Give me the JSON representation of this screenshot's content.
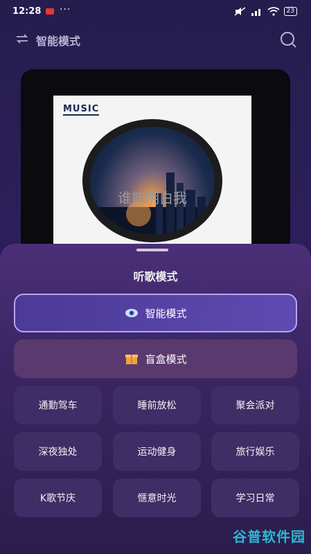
{
  "status": {
    "time": "12:28",
    "dots": "···",
    "battery": "23"
  },
  "header": {
    "title": "智能模式"
  },
  "player": {
    "logo": "MUSIC",
    "song": "谁能明白我"
  },
  "sheet": {
    "title": "听歌模式",
    "smart_label": "智能模式",
    "blind_label": "盲盒模式",
    "scenes": [
      "通勤驾车",
      "睡前放松",
      "聚会派对",
      "深夜独处",
      "运动健身",
      "旅行娱乐",
      "K歌节庆",
      "惬意时光",
      "学习日常"
    ]
  },
  "watermark": "谷普软件园",
  "colors": {
    "accent_border": "#b6a6f7",
    "sheet_top": "#4b2f78",
    "watermark": "#2bb8d3"
  }
}
